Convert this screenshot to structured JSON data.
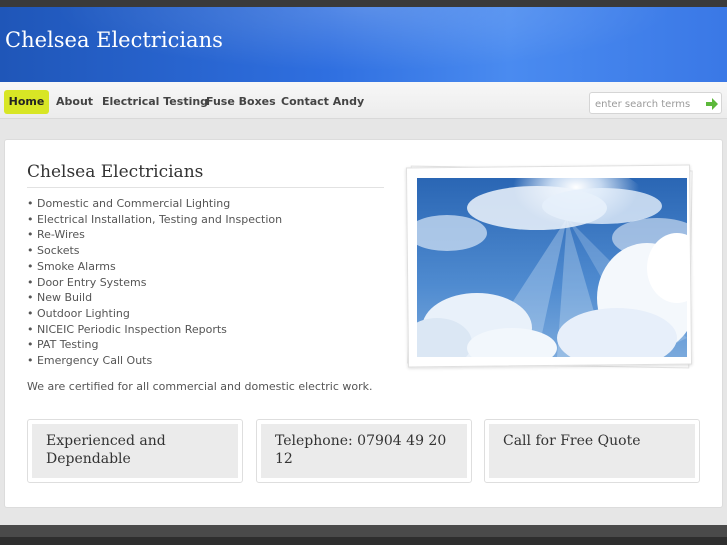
{
  "header": {
    "site_title": "Chelsea Electricians"
  },
  "nav": {
    "items": [
      {
        "label": "Home",
        "active": true
      },
      {
        "label": "About"
      },
      {
        "label": "Electrical Testing"
      },
      {
        "label": "Fuse Boxes"
      },
      {
        "label": "Contact Andy"
      }
    ]
  },
  "search": {
    "placeholder": "enter search terms",
    "go_icon": "green-arrow-icon"
  },
  "main": {
    "title": "Chelsea Electricians",
    "services": [
      "• Domestic and Commercial Lighting",
      "• Electrical Installation, Testing and Inspection",
      "• Re-Wires",
      "• Sockets",
      "• Smoke Alarms",
      "• Door Entry Systems",
      "• New Build",
      "• Outdoor Lighting",
      "• NICEIC Periodic Inspection Reports",
      "• PAT Testing",
      "• Emergency Call Outs"
    ],
    "certified": "We are certified for all commercial and domestic electric work."
  },
  "boxes": [
    "Experienced and Dependable",
    "Telephone: 07904 49 20 12",
    "Call for Free Quote"
  ],
  "colors": {
    "header_blue": "#2f6fe0",
    "nav_active": "#d8e625",
    "search_arrow": "#5cb83a"
  }
}
